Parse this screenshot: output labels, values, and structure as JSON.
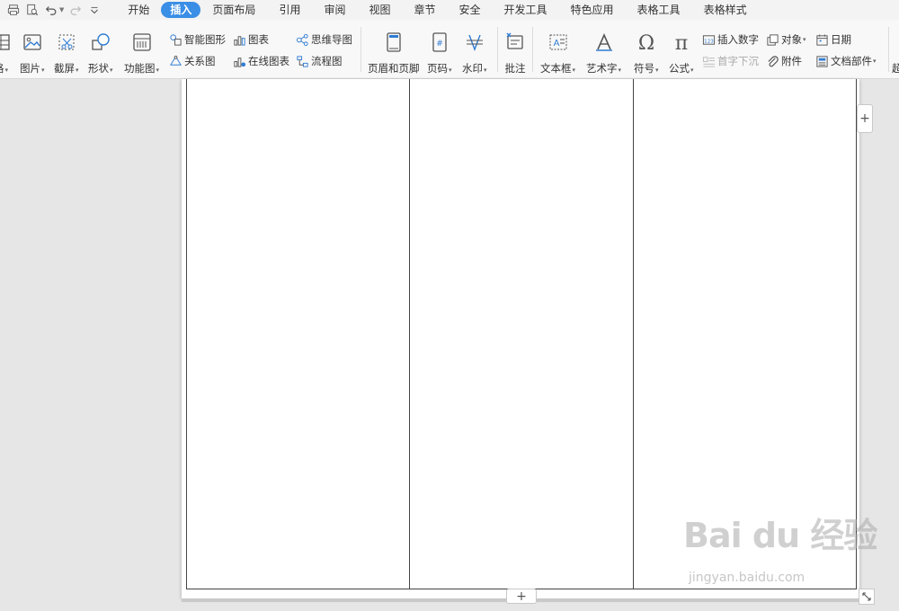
{
  "menubar": {
    "tabs": [
      {
        "label": "开始"
      },
      {
        "label": "插入",
        "active": true
      },
      {
        "label": "页面布局"
      },
      {
        "label": "引用"
      },
      {
        "label": "审阅"
      },
      {
        "label": "视图"
      },
      {
        "label": "章节"
      },
      {
        "label": "安全"
      },
      {
        "label": "开发工具"
      },
      {
        "label": "特色应用"
      },
      {
        "label": "表格工具"
      },
      {
        "label": "表格样式"
      }
    ]
  },
  "ribbon": {
    "table_partial": "格",
    "picture": "图片",
    "screenshot": "截屏",
    "shape": "形状",
    "function_chart": "功能图",
    "smart_art": "智能图形",
    "chart": "图表",
    "mind_map": "思维导图",
    "relation_chart": "关系图",
    "online_chart": "在线图表",
    "flowchart": "流程图",
    "header_footer": "页眉和页脚",
    "page_number": "页码",
    "watermark": "水印",
    "comment": "批注",
    "text_box": "文本框",
    "word_art": "艺术字",
    "symbol": "符号",
    "formula": "公式",
    "insert_number": "插入数字",
    "drop_cap": "首字下沉",
    "object": "对象",
    "attachment": "附件",
    "date": "日期",
    "doc_parts": "文档部件",
    "overflow_partial": "超"
  },
  "document": {
    "columns": 3
  },
  "watermark": {
    "logo": "Bai du 经验",
    "url": "jingyan.baidu.com"
  },
  "colors": {
    "accent": "#3a8ee6",
    "icon_blue": "#2f7cd3",
    "table_border": "#444444"
  }
}
